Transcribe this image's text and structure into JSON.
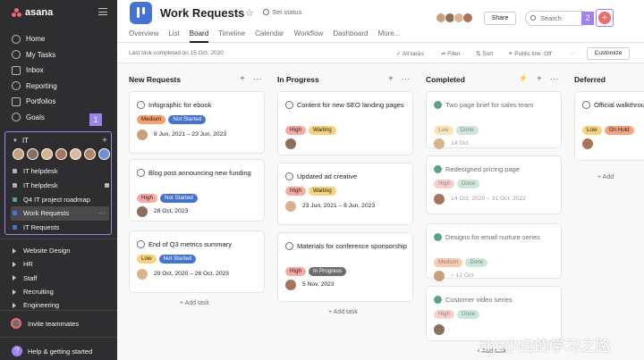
{
  "sidebar": {
    "app_name": "asana",
    "nav": [
      {
        "label": "Home",
        "icon": "home-icon"
      },
      {
        "label": "My Tasks",
        "icon": "check-circle-icon"
      },
      {
        "label": "Inbox",
        "icon": "inbox-icon"
      },
      {
        "label": "Reporting",
        "icon": "chart-icon"
      },
      {
        "label": "Portfolios",
        "icon": "folder-icon"
      },
      {
        "label": "Goals",
        "icon": "person-icon"
      }
    ],
    "badge1": "1",
    "team_name": "IT",
    "team_add": "+",
    "avatar_colors": [
      "#c7a17a",
      "#8a6f5a",
      "#d9b38c",
      "#a8745c",
      "#e0b79a",
      "#b38766",
      "#6f8fd8"
    ],
    "projects": [
      {
        "label": "IT helpdesk",
        "color": "#b2b0b0"
      },
      {
        "label": "IT helpdesk",
        "color": "#b2b0b0"
      },
      {
        "label": "Q4 IT project roadmap",
        "color": "#5da283"
      },
      {
        "label": "Work Requests",
        "color": "#4573d2"
      },
      {
        "label": "IT Requests",
        "color": "#4573d2"
      }
    ],
    "teams": [
      "Website Design",
      "HR",
      "Staff",
      "Recruiting",
      "Engineering"
    ],
    "invite": "Invite teammates",
    "help": "Help & getting started",
    "help_icon": "?"
  },
  "header": {
    "title": "Work Requests",
    "status": "Set status",
    "tabs": [
      "Overview",
      "List",
      "Board",
      "Timeline",
      "Calendar",
      "Workflow",
      "Dashboard",
      "More..."
    ],
    "share": "Share",
    "search_placeholder": "Search",
    "badge2": "2",
    "add": "+"
  },
  "subbar": {
    "last_task": "Last task completed on 15 Oct, 2020",
    "all_tasks": "All tasks",
    "filter": "Filter",
    "sort": "Sort",
    "public_link": "Public link: Off",
    "more": "···",
    "customize": "Customize"
  },
  "colors": {
    "high": {
      "bg": "#f9aaa2",
      "fg": "#1e1f21"
    },
    "medium": {
      "bg": "#f5a06b",
      "fg": "#1e1f21"
    },
    "low": {
      "bg": "#f6d37a",
      "fg": "#1e1f21"
    },
    "not_started": {
      "bg": "#4573d2",
      "fg": "#ffffff"
    },
    "waiting": {
      "bg": "#f6d37a",
      "fg": "#1e1f21"
    },
    "in_progress": {
      "bg": "#6d6e6f",
      "fg": "#ffffff"
    },
    "done": {
      "bg": "#9fd4b7",
      "fg": "#1e1f21"
    },
    "on_hold": {
      "bg": "#f6a383",
      "fg": "#1e1f21"
    }
  },
  "columns": [
    {
      "name": "New Requests",
      "add_task": "+ Add task",
      "cards": [
        {
          "title": "Infographic for ebook",
          "tags": [
            [
              "Medium",
              "medium"
            ],
            [
              "Not Started",
              "not_started"
            ]
          ],
          "date": "8 Jun, 2021 – 23 Jun, 2023",
          "done": false
        },
        {
          "title": "Blog post announcing new funding",
          "tags": [
            [
              "High",
              "high"
            ],
            [
              "Not Started",
              "not_started"
            ]
          ],
          "date": "28 Oct, 2023",
          "done": false
        },
        {
          "title": "End of Q3 metrics summary",
          "tags": [
            [
              "Low",
              "low"
            ],
            [
              "Not Started",
              "not_started"
            ]
          ],
          "date": "29 Oct, 2020 – 26 Oct, 2023",
          "done": false
        }
      ]
    },
    {
      "name": "In Progress",
      "add_task": "+ Add task",
      "cards": [
        {
          "title": "Content for new SEO landing pages",
          "tags": [
            [
              "High",
              "high"
            ],
            [
              "Waiting",
              "waiting"
            ]
          ],
          "date": "",
          "done": false
        },
        {
          "title": "Updated ad creative",
          "tags": [
            [
              "High",
              "high"
            ],
            [
              "Waiting",
              "waiting"
            ]
          ],
          "date": "23 Jun, 2021 – 8 Jun, 2023",
          "done": false
        },
        {
          "title": "Materials for conference sponsorship",
          "tags": [
            [
              "High",
              "high"
            ],
            [
              "In Progress",
              "in_progress"
            ]
          ],
          "date": "5 Nov, 2023",
          "done": false
        }
      ]
    },
    {
      "name": "Completed",
      "add_task": "+ Add task",
      "cards": [
        {
          "title": "Two page brief for sales team",
          "tags": [
            [
              "Low",
              "low"
            ],
            [
              "Done",
              "done"
            ]
          ],
          "date": "14 Oct",
          "done": true
        },
        {
          "title": "Redesigned pricing page",
          "tags": [
            [
              "High",
              "high"
            ],
            [
              "Done",
              "done"
            ]
          ],
          "date": "14 Oct, 2020 – 31 Oct, 2022",
          "done": true
        },
        {
          "title": "Designs for email nurture series",
          "tags": [
            [
              "Medium",
              "medium"
            ],
            [
              "Done",
              "done"
            ]
          ],
          "date": "– 12 Oct",
          "done": true
        },
        {
          "title": "Customer video series",
          "tags": [
            [
              "High",
              "high"
            ],
            [
              "Done",
              "done"
            ]
          ],
          "date": "",
          "done": true
        }
      ]
    },
    {
      "name": "Deferred",
      "add_task": "+ Add",
      "cards": [
        {
          "title": "Official walkthrough for candidates",
          "tags": [
            [
              "Low",
              "low"
            ],
            [
              "On Hold",
              "on_hold"
            ]
          ],
          "date": "",
          "done": false
        }
      ]
    }
  ],
  "watermark": "zhz小白的学习之路"
}
